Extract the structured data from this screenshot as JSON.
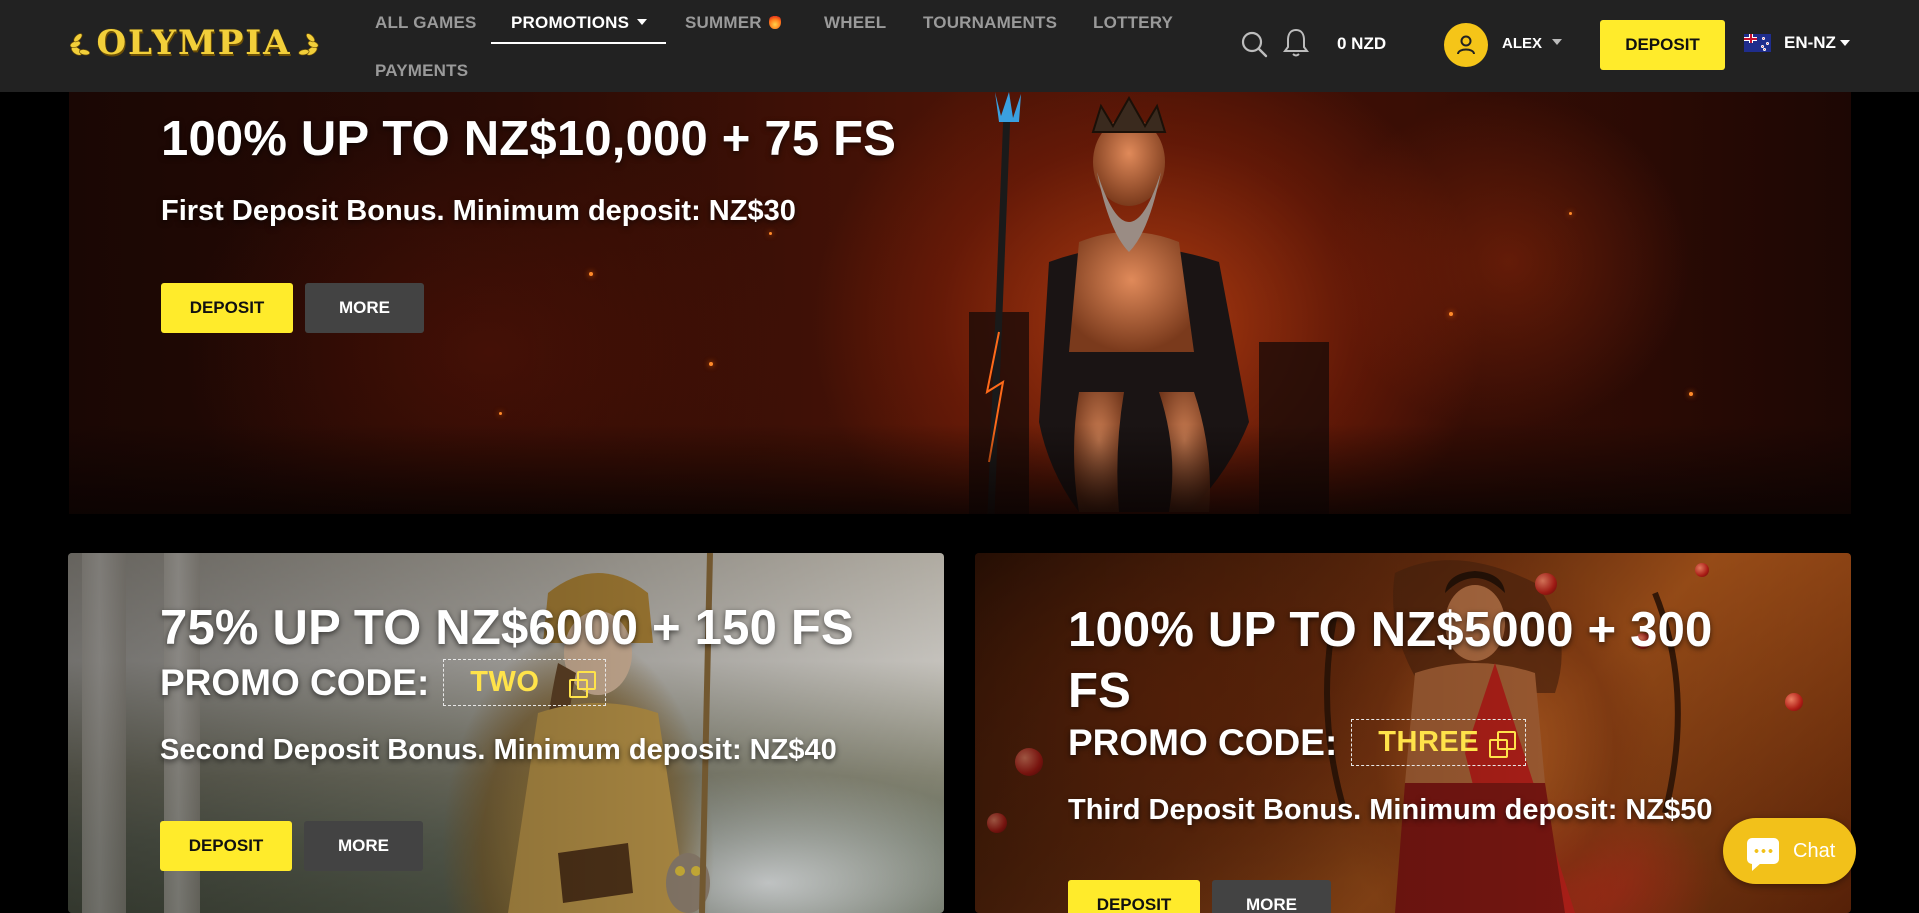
{
  "brand": {
    "logo_text": "OLYMPIA"
  },
  "nav": {
    "items": [
      {
        "label": "ALL GAMES"
      },
      {
        "label": "PROMOTIONS"
      },
      {
        "label": "SUMMER"
      },
      {
        "label": "WHEEL"
      },
      {
        "label": "TOURNAMENTS"
      },
      {
        "label": "LOTTERY"
      },
      {
        "label": "PAYMENTS"
      }
    ],
    "active": "PROMOTIONS"
  },
  "header": {
    "balance": "0 NZD",
    "username": "ALEX",
    "deposit_label": "DEPOSIT",
    "language": "EN-NZ",
    "icons": [
      "search-icon",
      "bell-icon",
      "user-icon",
      "nz-flag-icon"
    ]
  },
  "hero": {
    "title": "100% UP TO NZ$10,000 + 75 FS",
    "subtitle": "First Deposit Bonus. Minimum deposit: NZ$30",
    "deposit_label": "DEPOSIT",
    "more_label": "MORE"
  },
  "cards": [
    {
      "title": "75% UP TO NZ$6000 + 150 FS",
      "promo_label": "PROMO CODE:",
      "promo_code": "TWO",
      "subtitle": "Second Deposit Bonus. Minimum deposit: NZ$40",
      "deposit_label": "DEPOSIT",
      "more_label": "MORE"
    },
    {
      "title_line1": "100% UP TO NZ$5000 + 300",
      "title_line2": "FS",
      "promo_label": "PROMO CODE:",
      "promo_code": "THREE",
      "subtitle": "Third Deposit Bonus. Minimum deposit: NZ$50",
      "deposit_label": "DEPOSIT",
      "more_label": "MORE"
    }
  ],
  "chat": {
    "label": "Chat"
  },
  "colors": {
    "accent": "#ffeb2b",
    "header_bg": "#222222",
    "chat": "#f2c11a",
    "promo_code": "#ffe34a"
  }
}
